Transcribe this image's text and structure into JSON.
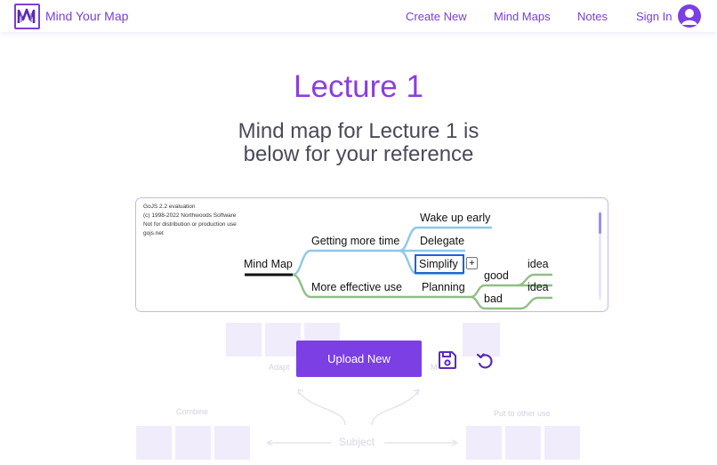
{
  "nav": {
    "brand": "Mind Your Map",
    "links": [
      "Create New",
      "Mind Maps",
      "Notes",
      "Sign In"
    ]
  },
  "page": {
    "title": "Lecture 1",
    "subtitle_line1": "Mind map for Lecture 1 is",
    "subtitle_line2": "below for your reference"
  },
  "mindmap": {
    "eval_lines": [
      "GoJS 2.2 evaluation",
      "(c) 1998-2022 Northwoods Software",
      "Not for distribution or production use",
      "gojs.net"
    ],
    "root": "Mind Map",
    "nodes": {
      "getting_more_time": "Getting more time",
      "wake_up_early": "Wake up early",
      "delegate": "Delegate",
      "simplify": "Simplify",
      "more_effective_use": "More effective use",
      "planning": "Planning",
      "good": "good",
      "bad": "bad",
      "idea1": "idea",
      "idea2": "idea"
    },
    "plus": "+",
    "colors": {
      "blue_branch": "#8ec8e8",
      "green_branch": "#90bf86",
      "selected": "#1e63d6"
    }
  },
  "actions": {
    "upload": "Upload New",
    "save_icon": "floppy-disk-icon",
    "refresh_icon": "refresh-icon"
  },
  "background": {
    "labels": [
      "Adapt",
      "M",
      "Combine",
      "Put to other use"
    ],
    "subject": "Subject"
  },
  "colors": {
    "accent": "#7b3fe4"
  }
}
